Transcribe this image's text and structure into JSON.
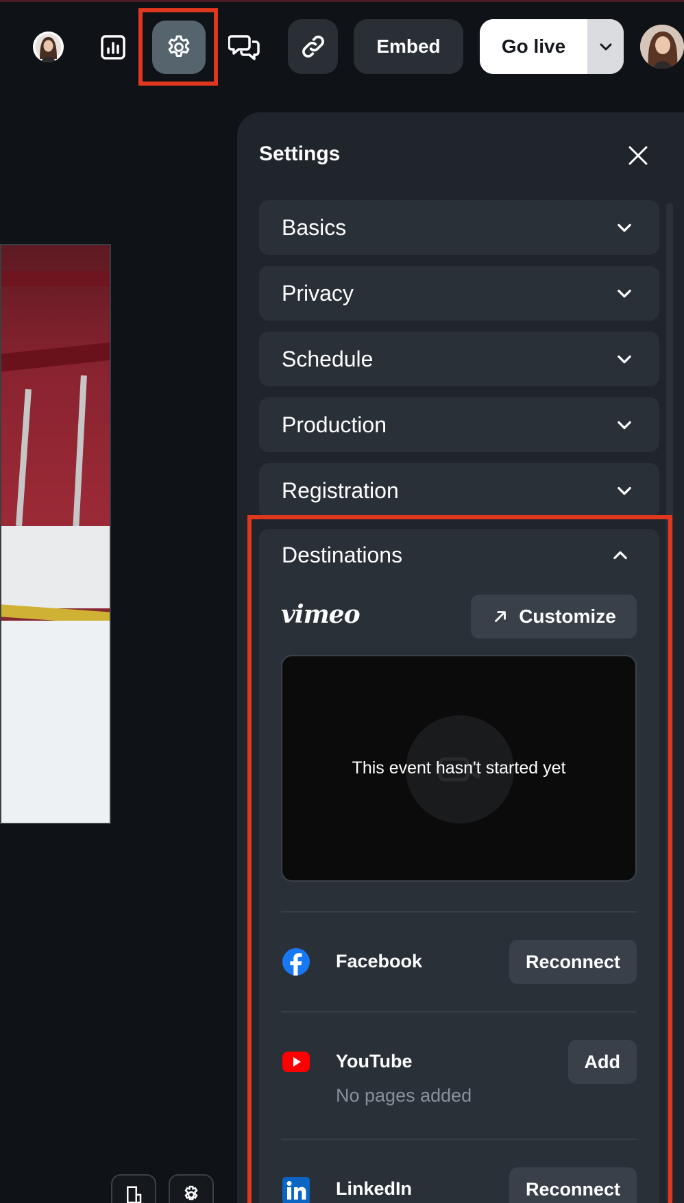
{
  "toolbar": {
    "embed_label": "Embed",
    "go_live_label": "Go live",
    "icons": [
      "avatar",
      "analytics-icon",
      "settings-icon",
      "chat-icon",
      "link-icon",
      "chevron-down-icon",
      "avatar"
    ]
  },
  "settings": {
    "title": "Settings",
    "sections": [
      {
        "label": "Basics",
        "expanded": false
      },
      {
        "label": "Privacy",
        "expanded": false
      },
      {
        "label": "Schedule",
        "expanded": false
      },
      {
        "label": "Production",
        "expanded": false
      },
      {
        "label": "Registration",
        "expanded": false
      }
    ],
    "destinations": {
      "label": "Destinations",
      "expanded": true,
      "brand": "vimeo",
      "customize_label": "Customize",
      "preview_message": "This event hasn't started yet",
      "items": [
        {
          "name": "Facebook",
          "action": "Reconnect",
          "sub": ""
        },
        {
          "name": "YouTube",
          "action": "Add",
          "sub": "No pages added"
        },
        {
          "name": "LinkedIn",
          "action": "Reconnect",
          "sub": ""
        }
      ]
    }
  },
  "colors": {
    "highlight": "#e2371f",
    "panel_bg": "#20252b",
    "section_bg": "#2a3038",
    "facebook": "#1877f2",
    "youtube": "#ff0000",
    "linkedin": "#0a66c2"
  }
}
